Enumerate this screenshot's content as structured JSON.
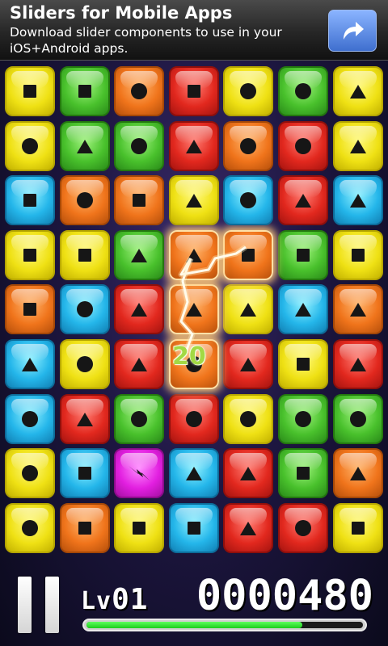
{
  "ad": {
    "title": "Sliders for Mobile Apps",
    "description": "Download slider components to use in your iOS+Android apps.",
    "action_icon": "share-arrow-icon"
  },
  "board": {
    "colors": {
      "yellow": "#efe114",
      "green": "#49c12c",
      "orange": "#f0741b",
      "red": "#e2281e",
      "blue": "#24b6ea",
      "magenta": "#e21fe0"
    },
    "rows": [
      [
        {
          "c": "yellow",
          "s": "square"
        },
        {
          "c": "green",
          "s": "square"
        },
        {
          "c": "orange",
          "s": "circle"
        },
        {
          "c": "red",
          "s": "square"
        },
        {
          "c": "yellow",
          "s": "circle"
        },
        {
          "c": "green",
          "s": "circle"
        },
        {
          "c": "yellow",
          "s": "triangle"
        }
      ],
      [
        {
          "c": "yellow",
          "s": "circle"
        },
        {
          "c": "green",
          "s": "triangle"
        },
        {
          "c": "green",
          "s": "circle"
        },
        {
          "c": "red",
          "s": "triangle"
        },
        {
          "c": "orange",
          "s": "circle"
        },
        {
          "c": "red",
          "s": "circle"
        },
        {
          "c": "yellow",
          "s": "triangle"
        }
      ],
      [
        {
          "c": "blue",
          "s": "square"
        },
        {
          "c": "orange",
          "s": "circle"
        },
        {
          "c": "orange",
          "s": "square"
        },
        {
          "c": "yellow",
          "s": "triangle"
        },
        {
          "c": "blue",
          "s": "circle"
        },
        {
          "c": "red",
          "s": "triangle"
        },
        {
          "c": "blue",
          "s": "triangle"
        }
      ],
      [
        {
          "c": "yellow",
          "s": "square"
        },
        {
          "c": "yellow",
          "s": "square"
        },
        {
          "c": "green",
          "s": "triangle"
        },
        {
          "c": "orange",
          "s": "triangle",
          "selected": true
        },
        {
          "c": "orange",
          "s": "square",
          "selected": true
        },
        {
          "c": "green",
          "s": "square"
        },
        {
          "c": "yellow",
          "s": "square"
        }
      ],
      [
        {
          "c": "orange",
          "s": "square"
        },
        {
          "c": "blue",
          "s": "circle"
        },
        {
          "c": "red",
          "s": "triangle"
        },
        {
          "c": "orange",
          "s": "triangle",
          "selected": true
        },
        {
          "c": "yellow",
          "s": "triangle"
        },
        {
          "c": "blue",
          "s": "triangle"
        },
        {
          "c": "orange",
          "s": "triangle"
        }
      ],
      [
        {
          "c": "blue",
          "s": "triangle"
        },
        {
          "c": "yellow",
          "s": "circle"
        },
        {
          "c": "red",
          "s": "triangle"
        },
        {
          "c": "orange",
          "s": "circle",
          "selected": true
        },
        {
          "c": "red",
          "s": "triangle"
        },
        {
          "c": "yellow",
          "s": "square"
        },
        {
          "c": "red",
          "s": "triangle"
        }
      ],
      [
        {
          "c": "blue",
          "s": "circle"
        },
        {
          "c": "red",
          "s": "triangle"
        },
        {
          "c": "green",
          "s": "circle"
        },
        {
          "c": "red",
          "s": "circle"
        },
        {
          "c": "yellow",
          "s": "circle"
        },
        {
          "c": "green",
          "s": "circle"
        },
        {
          "c": "green",
          "s": "circle"
        }
      ],
      [
        {
          "c": "yellow",
          "s": "circle"
        },
        {
          "c": "blue",
          "s": "square"
        },
        {
          "c": "magenta",
          "s": "lightning"
        },
        {
          "c": "blue",
          "s": "triangle"
        },
        {
          "c": "red",
          "s": "triangle"
        },
        {
          "c": "green",
          "s": "square"
        },
        {
          "c": "orange",
          "s": "triangle"
        }
      ],
      [
        {
          "c": "yellow",
          "s": "circle"
        },
        {
          "c": "orange",
          "s": "square"
        },
        {
          "c": "yellow",
          "s": "square"
        },
        {
          "c": "blue",
          "s": "square"
        },
        {
          "c": "red",
          "s": "triangle"
        },
        {
          "c": "red",
          "s": "circle"
        },
        {
          "c": "yellow",
          "s": "square"
        }
      ]
    ],
    "combo_popup": "20"
  },
  "hud": {
    "pause_icon": "pause-icon",
    "level_prefix": "Lv",
    "level_value": "01",
    "score": "0000480",
    "progress_fraction": 0.78,
    "progress_color": "#1ccd1c"
  }
}
